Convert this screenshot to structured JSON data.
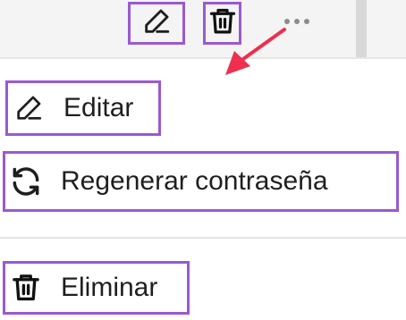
{
  "toolbar": {
    "edit_icon": "pencil-icon",
    "delete_icon": "trash-icon",
    "more_icon": "more-horizontal-icon"
  },
  "menu": {
    "items": [
      {
        "label": "Editar",
        "icon": "pencil-icon"
      },
      {
        "label": "Regenerar contraseña",
        "icon": "refresh-icon"
      },
      {
        "label": "Eliminar",
        "icon": "trash-icon"
      }
    ]
  },
  "colors": {
    "highlight": "#9b59d0",
    "annotation_arrow": "#ee2f4e",
    "toolbar_bg": "#f4f4f4",
    "text": "#1f1f1f"
  }
}
